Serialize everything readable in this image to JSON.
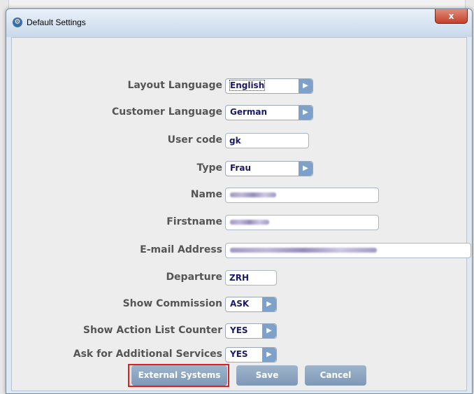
{
  "window": {
    "title": "Default Settings",
    "close_glyph": "x",
    "app_icon": "gear-icon"
  },
  "form": {
    "layout_language": {
      "label": "Layout Language",
      "value": "English"
    },
    "customer_language": {
      "label": "Customer Language",
      "value": "German"
    },
    "user_code": {
      "label": "User code",
      "value": "gk"
    },
    "type": {
      "label": "Type",
      "value": "Frau"
    },
    "name": {
      "label": "Name"
    },
    "firstname": {
      "label": "Firstname"
    },
    "email": {
      "label": "E-mail Address"
    },
    "departure": {
      "label": "Departure",
      "value": "ZRH"
    },
    "show_commission": {
      "label": "Show Commission",
      "value": "ASK"
    },
    "show_action_list_counter": {
      "label": "Show Action List Counter",
      "value": "YES"
    },
    "ask_additional_services": {
      "label": "Ask for Additional Services",
      "value": "YES"
    }
  },
  "buttons": {
    "external_systems": "External Systems",
    "save": "Save",
    "cancel": "Cancel"
  },
  "colors": {
    "button": "#8aa3c0",
    "highlight": "#e0201a",
    "dropdown_arrow": "#7da1c9"
  }
}
